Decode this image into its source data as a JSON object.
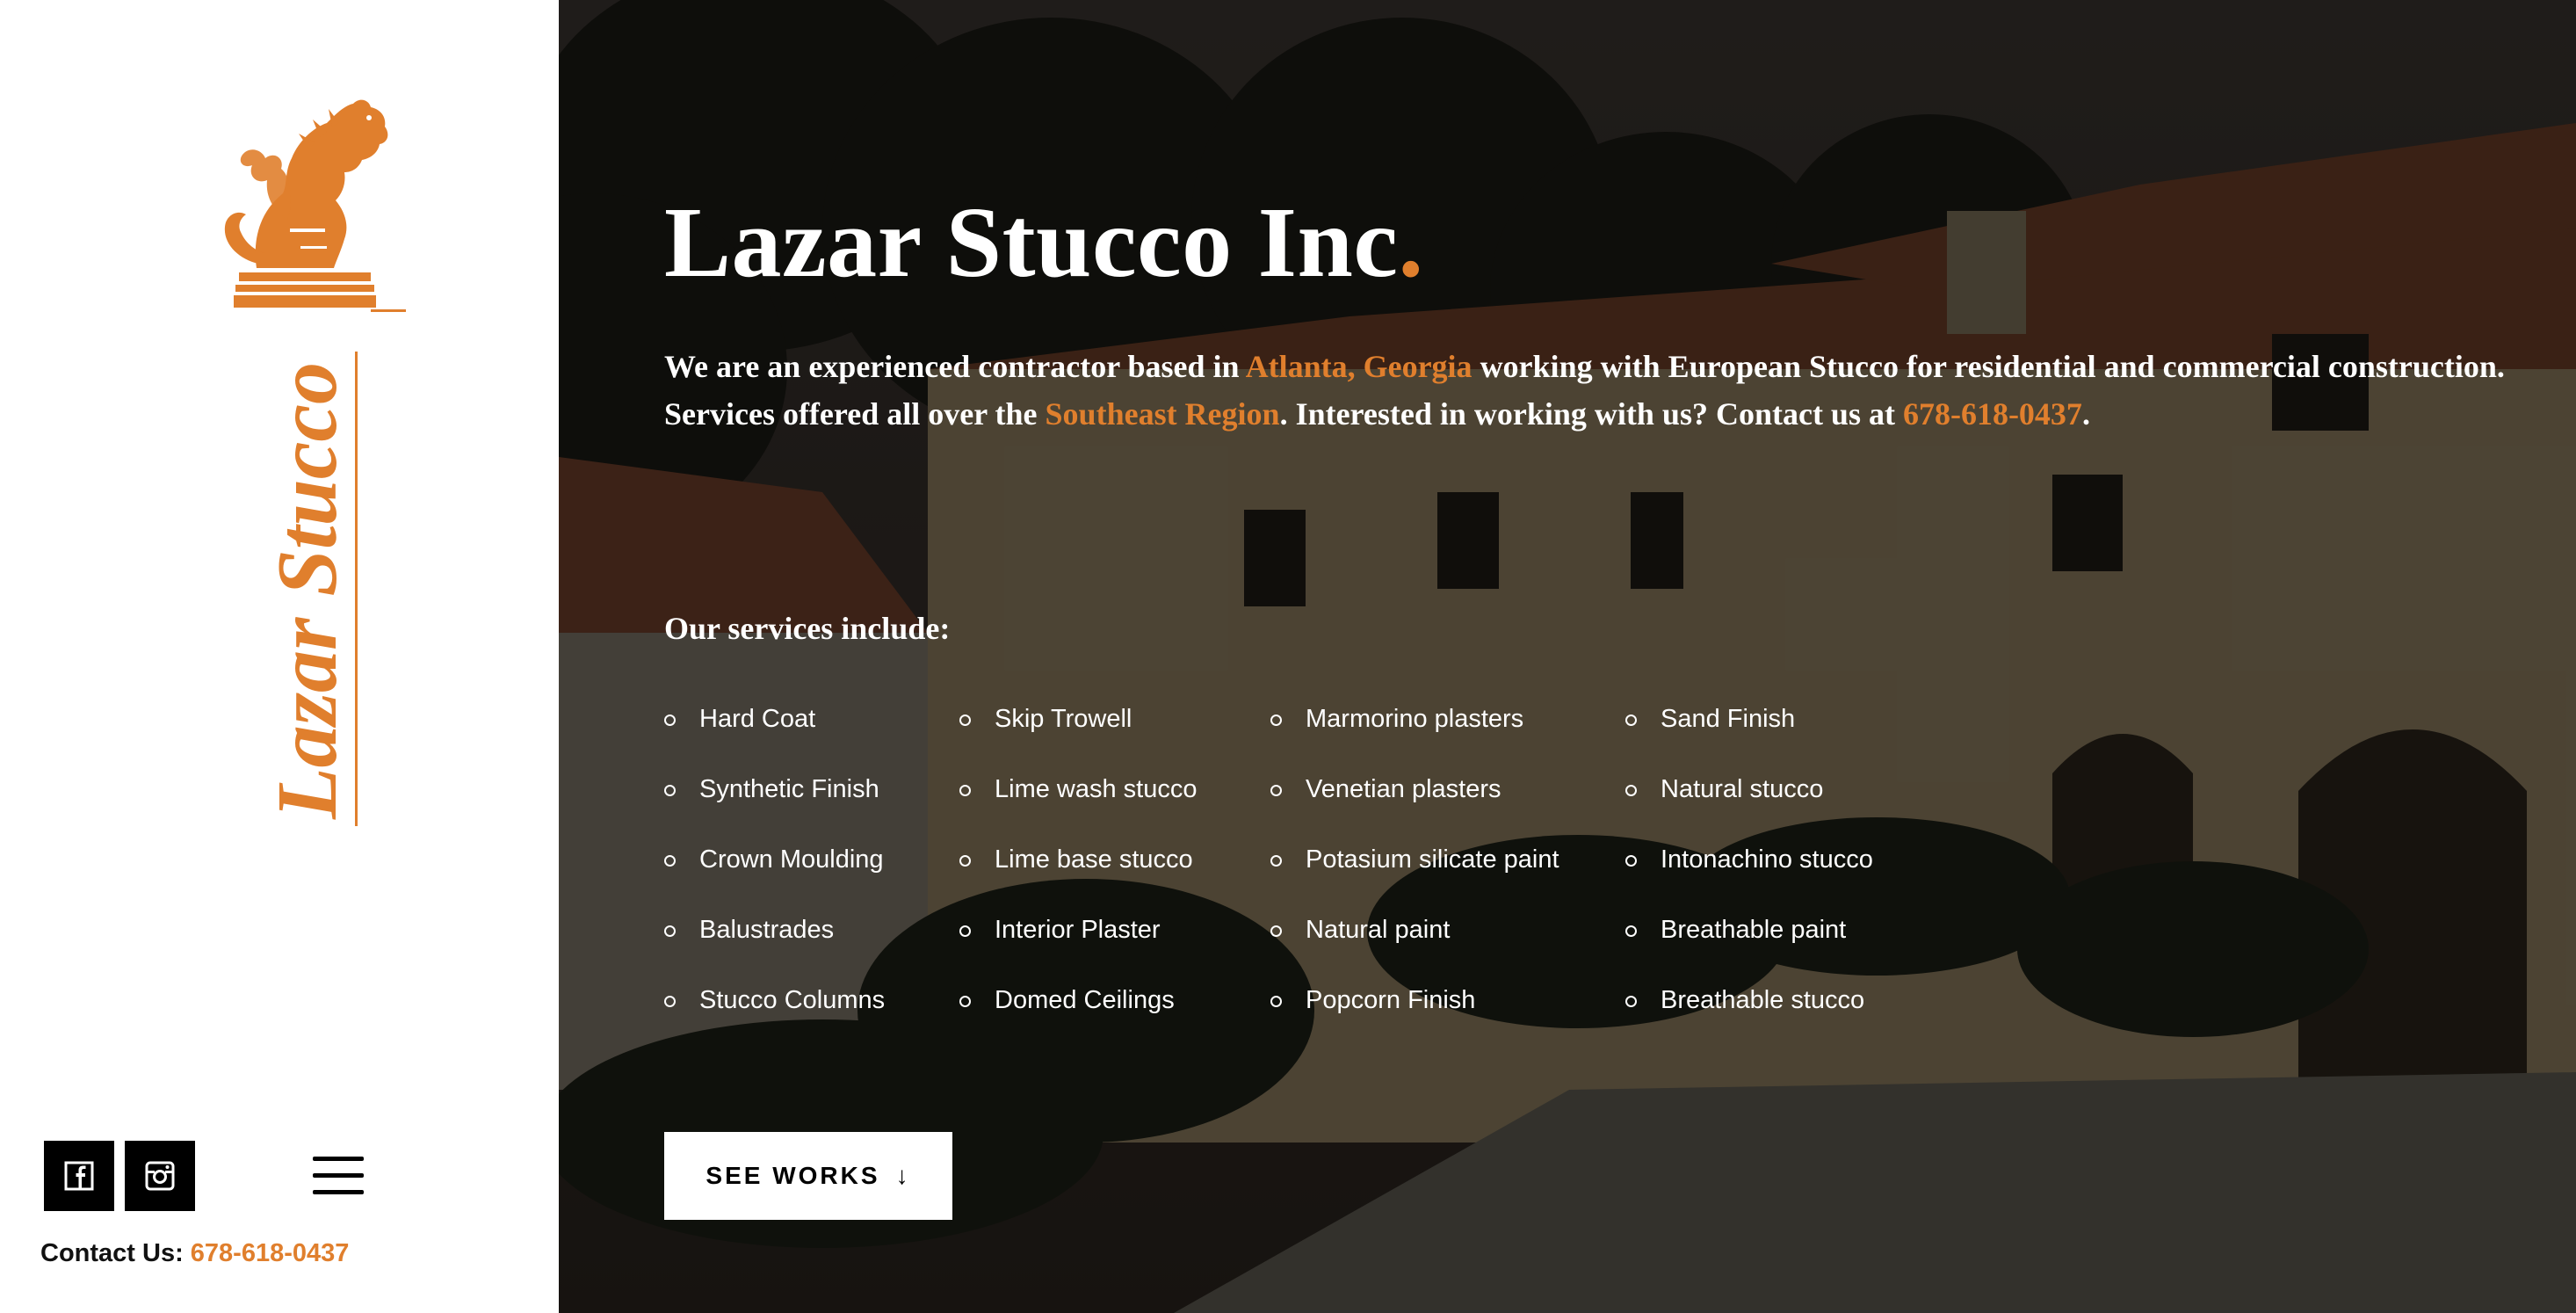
{
  "brand": {
    "logo_wordmark": "Lazar Stucco",
    "accent_color": "#e07f2d"
  },
  "sidebar": {
    "social": [
      {
        "name": "facebook",
        "icon": "facebook-icon"
      },
      {
        "name": "instagram",
        "icon": "instagram-icon"
      }
    ],
    "menu_icon": "hamburger-menu-icon",
    "contact_label": "Contact Us:",
    "contact_phone": "678-618-0437"
  },
  "hero": {
    "title": "Lazar Stucco Inc",
    "title_dot": ".",
    "intro": {
      "l1_a": "We are an experienced contractor based in ",
      "l1_location": "Atlanta, Georgia",
      "l1_b": " working with European Stucco for residential and commercial construction.",
      "l2_a": "Services offered all over the ",
      "l2_region": "Southeast Region",
      "l2_b": ". Interested in working with us? Contact us at ",
      "l2_phone": "678-618-0437",
      "l2_end": "."
    },
    "services_heading": "Our services include:",
    "services_columns": [
      [
        "Hard Coat",
        "Synthetic Finish",
        "Crown Moulding",
        "Balustrades",
        "Stucco Columns"
      ],
      [
        "Skip Trowell",
        "Lime wash stucco",
        "Lime base stucco",
        "Interior Plaster",
        "Domed Ceilings"
      ],
      [
        "Marmorino plasters",
        "Venetian plasters",
        "Potasium silicate paint",
        "Natural paint",
        "Popcorn Finish"
      ],
      [
        "Sand Finish",
        "Natural stucco",
        "Intonachino stucco",
        "Breathable paint",
        "Breathable stucco"
      ]
    ],
    "cta_label": "SEE WORKS",
    "cta_arrow": "↓"
  }
}
